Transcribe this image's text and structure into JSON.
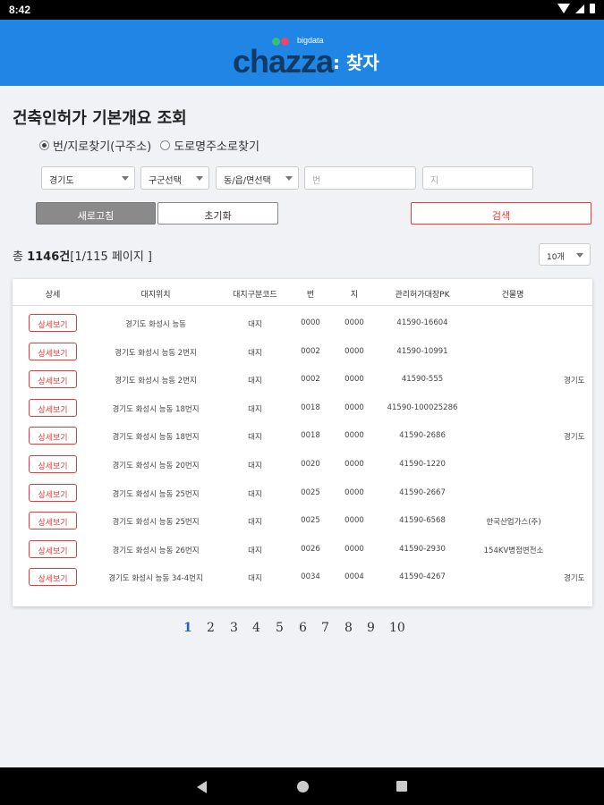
{
  "status": {
    "time": "8:42"
  },
  "logo": {
    "brand": "chazza",
    "suffix": ": 찾자",
    "tag": "bigdata"
  },
  "page_title": "건축인허가 기본개요 조회",
  "search_mode": {
    "options": [
      {
        "label": "번/지로찾기(구주소)",
        "selected": true
      },
      {
        "label": "도로명주소로찾기",
        "selected": false
      }
    ]
  },
  "filters": {
    "province": "경기도",
    "district": "구군선택",
    "town": "동/읍/면선택",
    "bun_placeholder": "번",
    "ji_placeholder": "지"
  },
  "buttons": {
    "refresh": "새로고침",
    "reset": "초기화",
    "search": "검색"
  },
  "summary": {
    "prefix": "총 ",
    "count": "1146건",
    "pages": "[1/115 페이지 ]"
  },
  "page_size": "10개",
  "table": {
    "headers": [
      "상세",
      "대지위치",
      "대지구분코드",
      "번",
      "지",
      "관리허가대장PK",
      "건물명"
    ],
    "detail_label": "상세보기",
    "rows": [
      {
        "location": "경기도 화성시 능동",
        "code": "대지",
        "bun": "0000",
        "ji": "0000",
        "pk": "41590-16604",
        "building": "",
        "extra": ""
      },
      {
        "location": "경기도 화성시 능동 2번지",
        "code": "대지",
        "bun": "0002",
        "ji": "0000",
        "pk": "41590-10991",
        "building": "",
        "extra": ""
      },
      {
        "location": "경기도 화성시 능동 2번지",
        "code": "대지",
        "bun": "0002",
        "ji": "0000",
        "pk": "41590-555",
        "building": "",
        "extra": "경기도"
      },
      {
        "location": "경기도 화성시 능동 18번지",
        "code": "대지",
        "bun": "0018",
        "ji": "0000",
        "pk": "41590-100025286",
        "building": "",
        "extra": ""
      },
      {
        "location": "경기도 화성시 능동 18번지",
        "code": "대지",
        "bun": "0018",
        "ji": "0000",
        "pk": "41590-2686",
        "building": "",
        "extra": "경기도"
      },
      {
        "location": "경기도 화성시 능동 20번지",
        "code": "대지",
        "bun": "0020",
        "ji": "0000",
        "pk": "41590-1220",
        "building": "",
        "extra": ""
      },
      {
        "location": "경기도 화성시 능동 25번지",
        "code": "대지",
        "bun": "0025",
        "ji": "0000",
        "pk": "41590-2667",
        "building": "",
        "extra": ""
      },
      {
        "location": "경기도 화성시 능동 25번지",
        "code": "대지",
        "bun": "0025",
        "ji": "0000",
        "pk": "41590-6568",
        "building": "한국산업가스(주)",
        "extra": ""
      },
      {
        "location": "경기도 화성시 능동 26번지",
        "code": "대지",
        "bun": "0026",
        "ji": "0000",
        "pk": "41590-2930",
        "building": "154KV병점변전소",
        "extra": ""
      },
      {
        "location": "경기도 화성시 능동 34-4번지",
        "code": "대지",
        "bun": "0034",
        "ji": "0004",
        "pk": "41590-4267",
        "building": "",
        "extra": "경기도"
      }
    ]
  },
  "pagination": {
    "pages": [
      "1",
      "2",
      "3",
      "4",
      "5",
      "6",
      "7",
      "8",
      "9",
      "10"
    ],
    "active": "1"
  }
}
